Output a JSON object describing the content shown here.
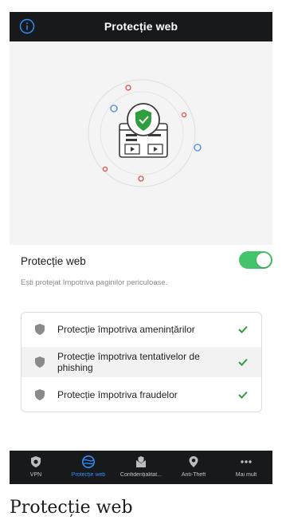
{
  "app": {
    "title": "Protecție web"
  },
  "protection": {
    "title": "Protecție web",
    "subtitle": "Ești protejat împotriva paginilor periculoase.",
    "enabled": true
  },
  "features": [
    {
      "label": "Protecție împotriva amenințărilor",
      "checked": true
    },
    {
      "label": "Protecție împotriva tentativelor de phishing",
      "checked": true
    },
    {
      "label": "Protecție împotriva fraudelor",
      "checked": true
    }
  ],
  "nav": [
    {
      "label": "VPN",
      "icon": "vpn-shield-icon",
      "active": false
    },
    {
      "label": "Protecție web",
      "icon": "web-protection-icon",
      "active": true
    },
    {
      "label": "Confidențialitat...",
      "icon": "privacy-icon",
      "active": false
    },
    {
      "label": "Anti-Theft",
      "icon": "anti-theft-icon",
      "active": false
    },
    {
      "label": "Mai mult",
      "icon": "more-icon",
      "active": false
    }
  ],
  "caption": "Protecție web",
  "colors": {
    "topbar": "#17191b",
    "hero_bg": "#f4f4f4",
    "toggle_on": "#44c46a",
    "check_green": "#2e9e3e",
    "shield_badge": "#2e9e3e",
    "active_nav": "#2f8fff"
  }
}
